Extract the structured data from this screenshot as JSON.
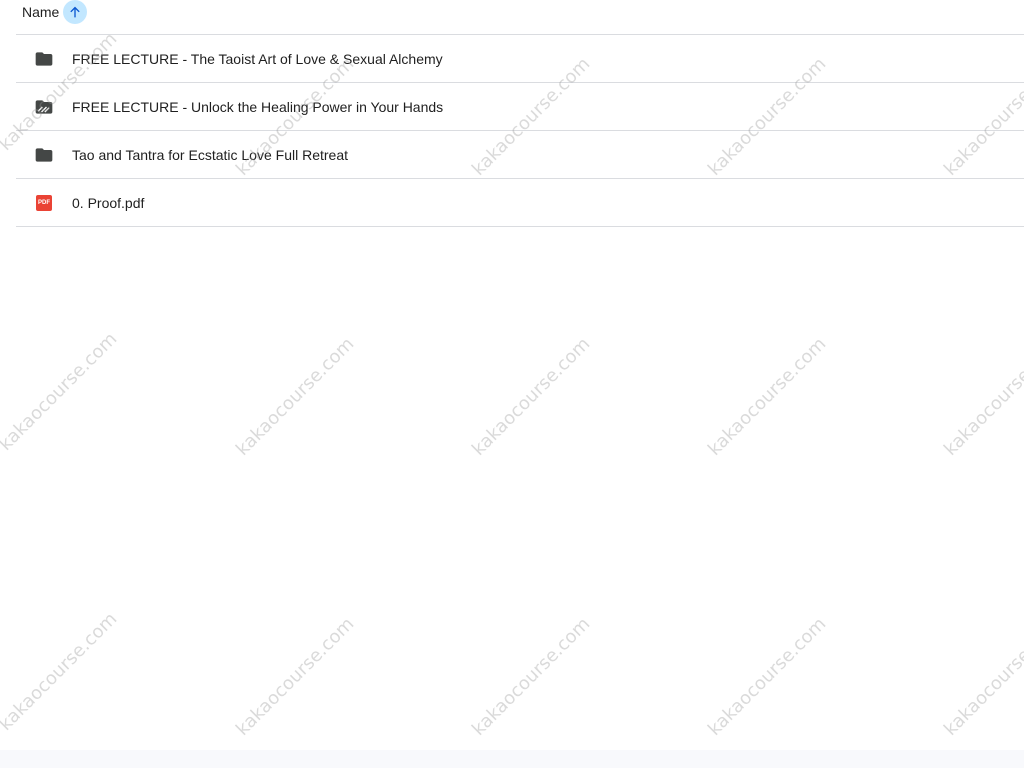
{
  "list": {
    "header": {
      "label": "Name",
      "sort_icon": "arrow-up-icon"
    },
    "items": [
      {
        "name": "FREE LECTURE - The Taoist Art of Love & Sexual Alchemy",
        "icon": "folder-icon"
      },
      {
        "name": "FREE LECTURE - Unlock the Healing Power in Your Hands",
        "icon": "shared-folder-icon"
      },
      {
        "name": "Tao and Tantra for Ecstatic Love Full Retreat",
        "icon": "folder-icon"
      },
      {
        "name": "0. Proof.pdf",
        "icon": "pdf-icon"
      }
    ]
  },
  "pdf_badge": "PDF",
  "watermark": "kakaocourse.com",
  "colors": {
    "sort_button_bg": "#c2e7ff",
    "folder_icon": "#444746",
    "pdf_red": "#ea4335",
    "divider": "#dadce0"
  }
}
